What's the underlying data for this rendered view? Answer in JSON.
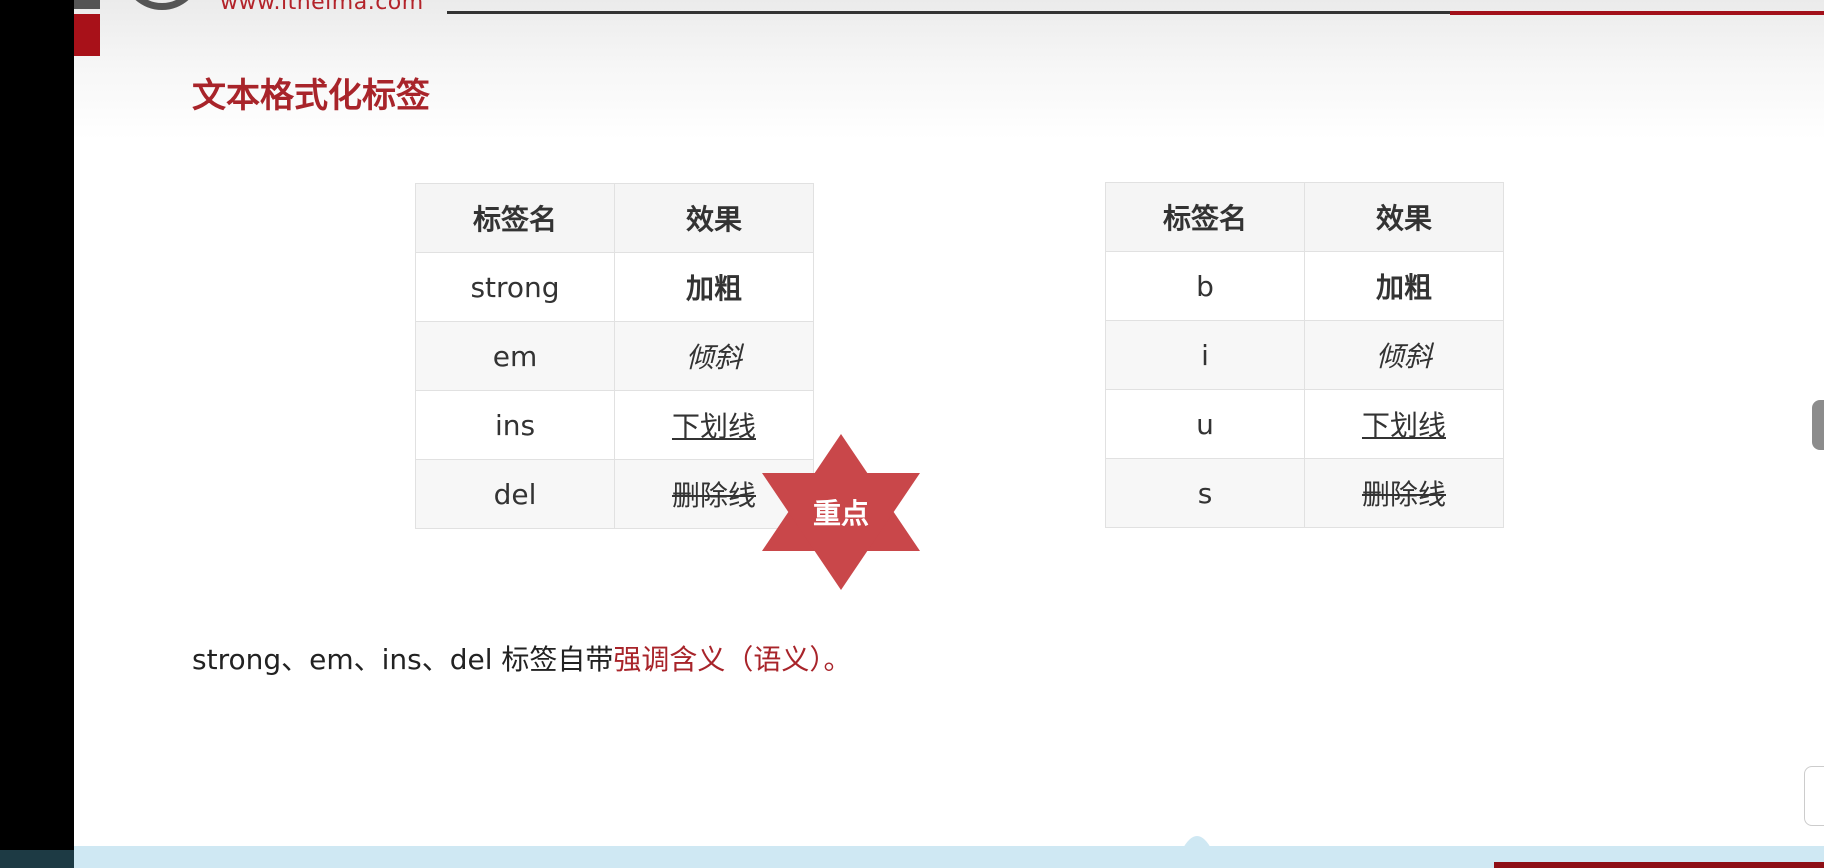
{
  "header": {
    "url_text": "www.itheima.com"
  },
  "slide": {
    "title": "文本格式化标签"
  },
  "table_left": {
    "headers": [
      "标签名",
      "效果"
    ],
    "rows": [
      {
        "tag": "strong",
        "effect": "加粗"
      },
      {
        "tag": "em",
        "effect": "倾斜"
      },
      {
        "tag": "ins",
        "effect": "下划线"
      },
      {
        "tag": "del",
        "effect": "删除线"
      }
    ]
  },
  "table_right": {
    "headers": [
      "标签名",
      "效果"
    ],
    "rows": [
      {
        "tag": "b",
        "effect": "加粗"
      },
      {
        "tag": "i",
        "effect": "倾斜"
      },
      {
        "tag": "u",
        "effect": "下划线"
      },
      {
        "tag": "s",
        "effect": "删除线"
      }
    ]
  },
  "badge": {
    "label": "重点",
    "color": "#c9474a"
  },
  "note": {
    "prefix": "strong、em、ins、del 标签自带",
    "emphasis": "强调含义（语义）",
    "suffix": "。"
  },
  "colors": {
    "accent": "#a8242a"
  }
}
